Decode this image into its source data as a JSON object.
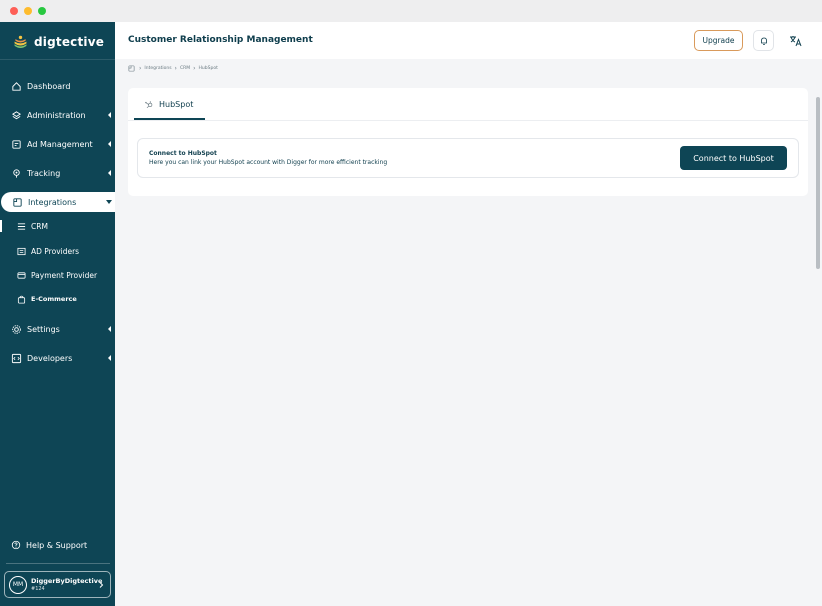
{
  "brand": {
    "name": "digtective"
  },
  "sidebar": {
    "items": [
      {
        "label": "Dashboard"
      },
      {
        "label": "Administration"
      },
      {
        "label": "Ad Management"
      },
      {
        "label": "Tracking"
      },
      {
        "label": "Integrations"
      },
      {
        "label": "Settings"
      },
      {
        "label": "Developers"
      }
    ],
    "sub_items": [
      {
        "label": "CRM"
      },
      {
        "label": "AD Providers"
      },
      {
        "label": "Payment Provider"
      },
      {
        "label": "E-Commerce"
      }
    ],
    "help": "Help & Support",
    "user": {
      "initials": "MM",
      "name": "DiggerByDigtective",
      "id": "#124"
    }
  },
  "header": {
    "title": "Customer Relationship Management",
    "upgrade_label": "Upgrade"
  },
  "breadcrumb": [
    "Integrations",
    "CRM",
    "HubSpot"
  ],
  "tabs": [
    {
      "label": "HubSpot"
    }
  ],
  "connect": {
    "title": "Connect to HubSpot",
    "description": "Here you can link your HubSpot account with Digger for more efficient tracking",
    "button_label": "Connect to HubSpot"
  },
  "colors": {
    "sidebar": "#0e4555",
    "accent": "#0e4555",
    "upgrade_border": "#d99a5b",
    "background": "#f4f5f7"
  }
}
